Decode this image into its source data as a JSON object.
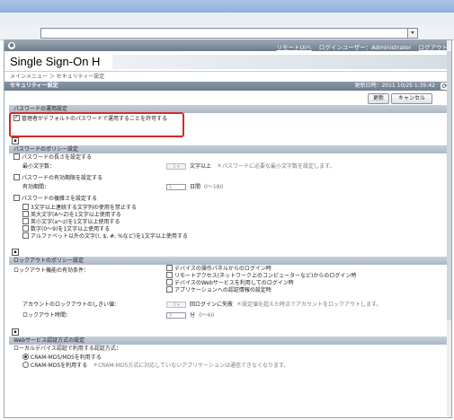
{
  "browser": {
    "address": "",
    "address_dropdown": "▾"
  },
  "topnav": {
    "remote_ui": "リモートUIへ",
    "login_user": "ログインユーザー：Administrator",
    "logout": "ログアウト"
  },
  "brand": "Single Sign-On H",
  "breadcrumb": "メインメニュー ＞ セキュリティー設定",
  "title": {
    "label": "セキュリティー設定",
    "datetime": "更新日時：2011 10/25 1:35:42"
  },
  "buttons": {
    "update": "更新",
    "cancel": "キャンセル"
  },
  "password_operation": {
    "heading": "パスワードの運用設定",
    "allow_default": "管理者がデフォルトのパスワードで運用することを許可する",
    "allow_default_checked": true
  },
  "password_policy": {
    "heading": "パスワードのポリシー設定",
    "min_length_label": "パスワードの長さを設定する",
    "min_length_checked": false,
    "min_chars_label": "最小文字数：",
    "min_chars_value": "1",
    "min_chars_unit": "文字以上",
    "min_chars_hint": "＊パスワードに必要な最小文字数を設定します。",
    "expiry_label": "パスワードの有効期限を設定する",
    "expiry_checked": false,
    "expiry_period_label": "有効期間：",
    "expiry_value": "1",
    "expiry_unit": "日間",
    "expiry_range": "0～180",
    "complexity_label": "パスワードの複雑さを設定する",
    "complexity_checked": false,
    "complexity_options": [
      "3文字以上連続する文字列の使用を禁止する",
      "英大文字(A～Z)を1文字以上使用する",
      "英小文字(a～z)を1文字以上使用する",
      "数字(0～9)を1文字以上使用する",
      "アルファベット以外の文字(!, $, #, %など)を1文字以上使用する"
    ]
  },
  "lockout_policy": {
    "heading": "ロックアウトのポリシー設定",
    "condition_label": "ロックアウト機能の有効条件：",
    "conditions": [
      "デバイスの操作パネルからのログイン時",
      "リモートアクセス(ネットワーク上のコンピューターなど)からのログイン時",
      "デバイスのWebサービスを利用してのログイン時",
      "アプリケーションへの認証情報の設定時"
    ],
    "threshold_label": "アカウントのロックアウトのしきい値：",
    "threshold_value": "3",
    "threshold_suffix": "回ログインに失敗",
    "threshold_hint": "＊設定値を超えた時点でアカウントをロックアウトします。",
    "duration_label": "ロックアウト時間：",
    "duration_value": "3",
    "duration_unit": "分",
    "duration_range": "0～60"
  },
  "webservice": {
    "heading": "Webサービス認証方式の設定",
    "method_label": "ローカルデバイス認証で利用する認証方式：",
    "options": [
      "CRAM-MD5/MD5を利用する",
      "CRAM-MD5を利用する"
    ],
    "selected_index": 0,
    "hint": "＊CRAM-MD5方式に対応していないアプリケーションは通信できなくなります。"
  },
  "collapse_icon": "▪"
}
